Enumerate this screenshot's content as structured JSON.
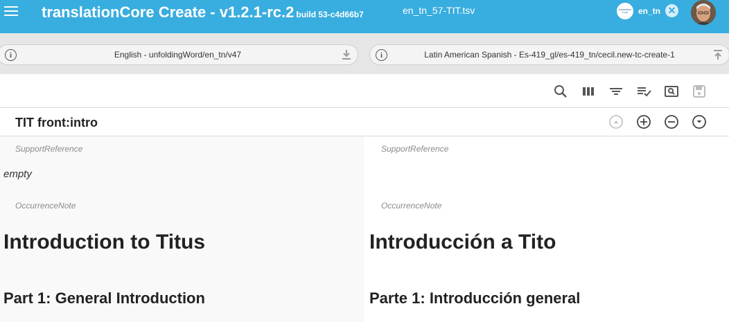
{
  "appbar": {
    "title": "translationCore Create - v1.2.1-rc.2",
    "build": "build 53-c4d66b7",
    "file_name": "en_tn_57-TIT.tsv",
    "org_logo_text": "translation Core",
    "resource_label": "en_tn",
    "accent_color": "#38ADDF"
  },
  "repos": {
    "source": "English - unfoldingWord/en_tn/v47",
    "target": "Latin American Spanish - Es-419_gl/es-419_tn/cecil.new-tc-create-1"
  },
  "row": {
    "title": "TIT front:intro"
  },
  "source_pane": {
    "support_reference_label": "SupportReference",
    "support_reference_value": "empty",
    "occurrence_note_label": "OccurrenceNote",
    "heading1": "Introduction to Titus",
    "heading2": "Part 1: General Introduction"
  },
  "target_pane": {
    "support_reference_label": "SupportReference",
    "occurrence_note_label": "OccurrenceNote",
    "heading1": "Introducción a Tito",
    "heading2": "Parte 1: Introducción general"
  }
}
